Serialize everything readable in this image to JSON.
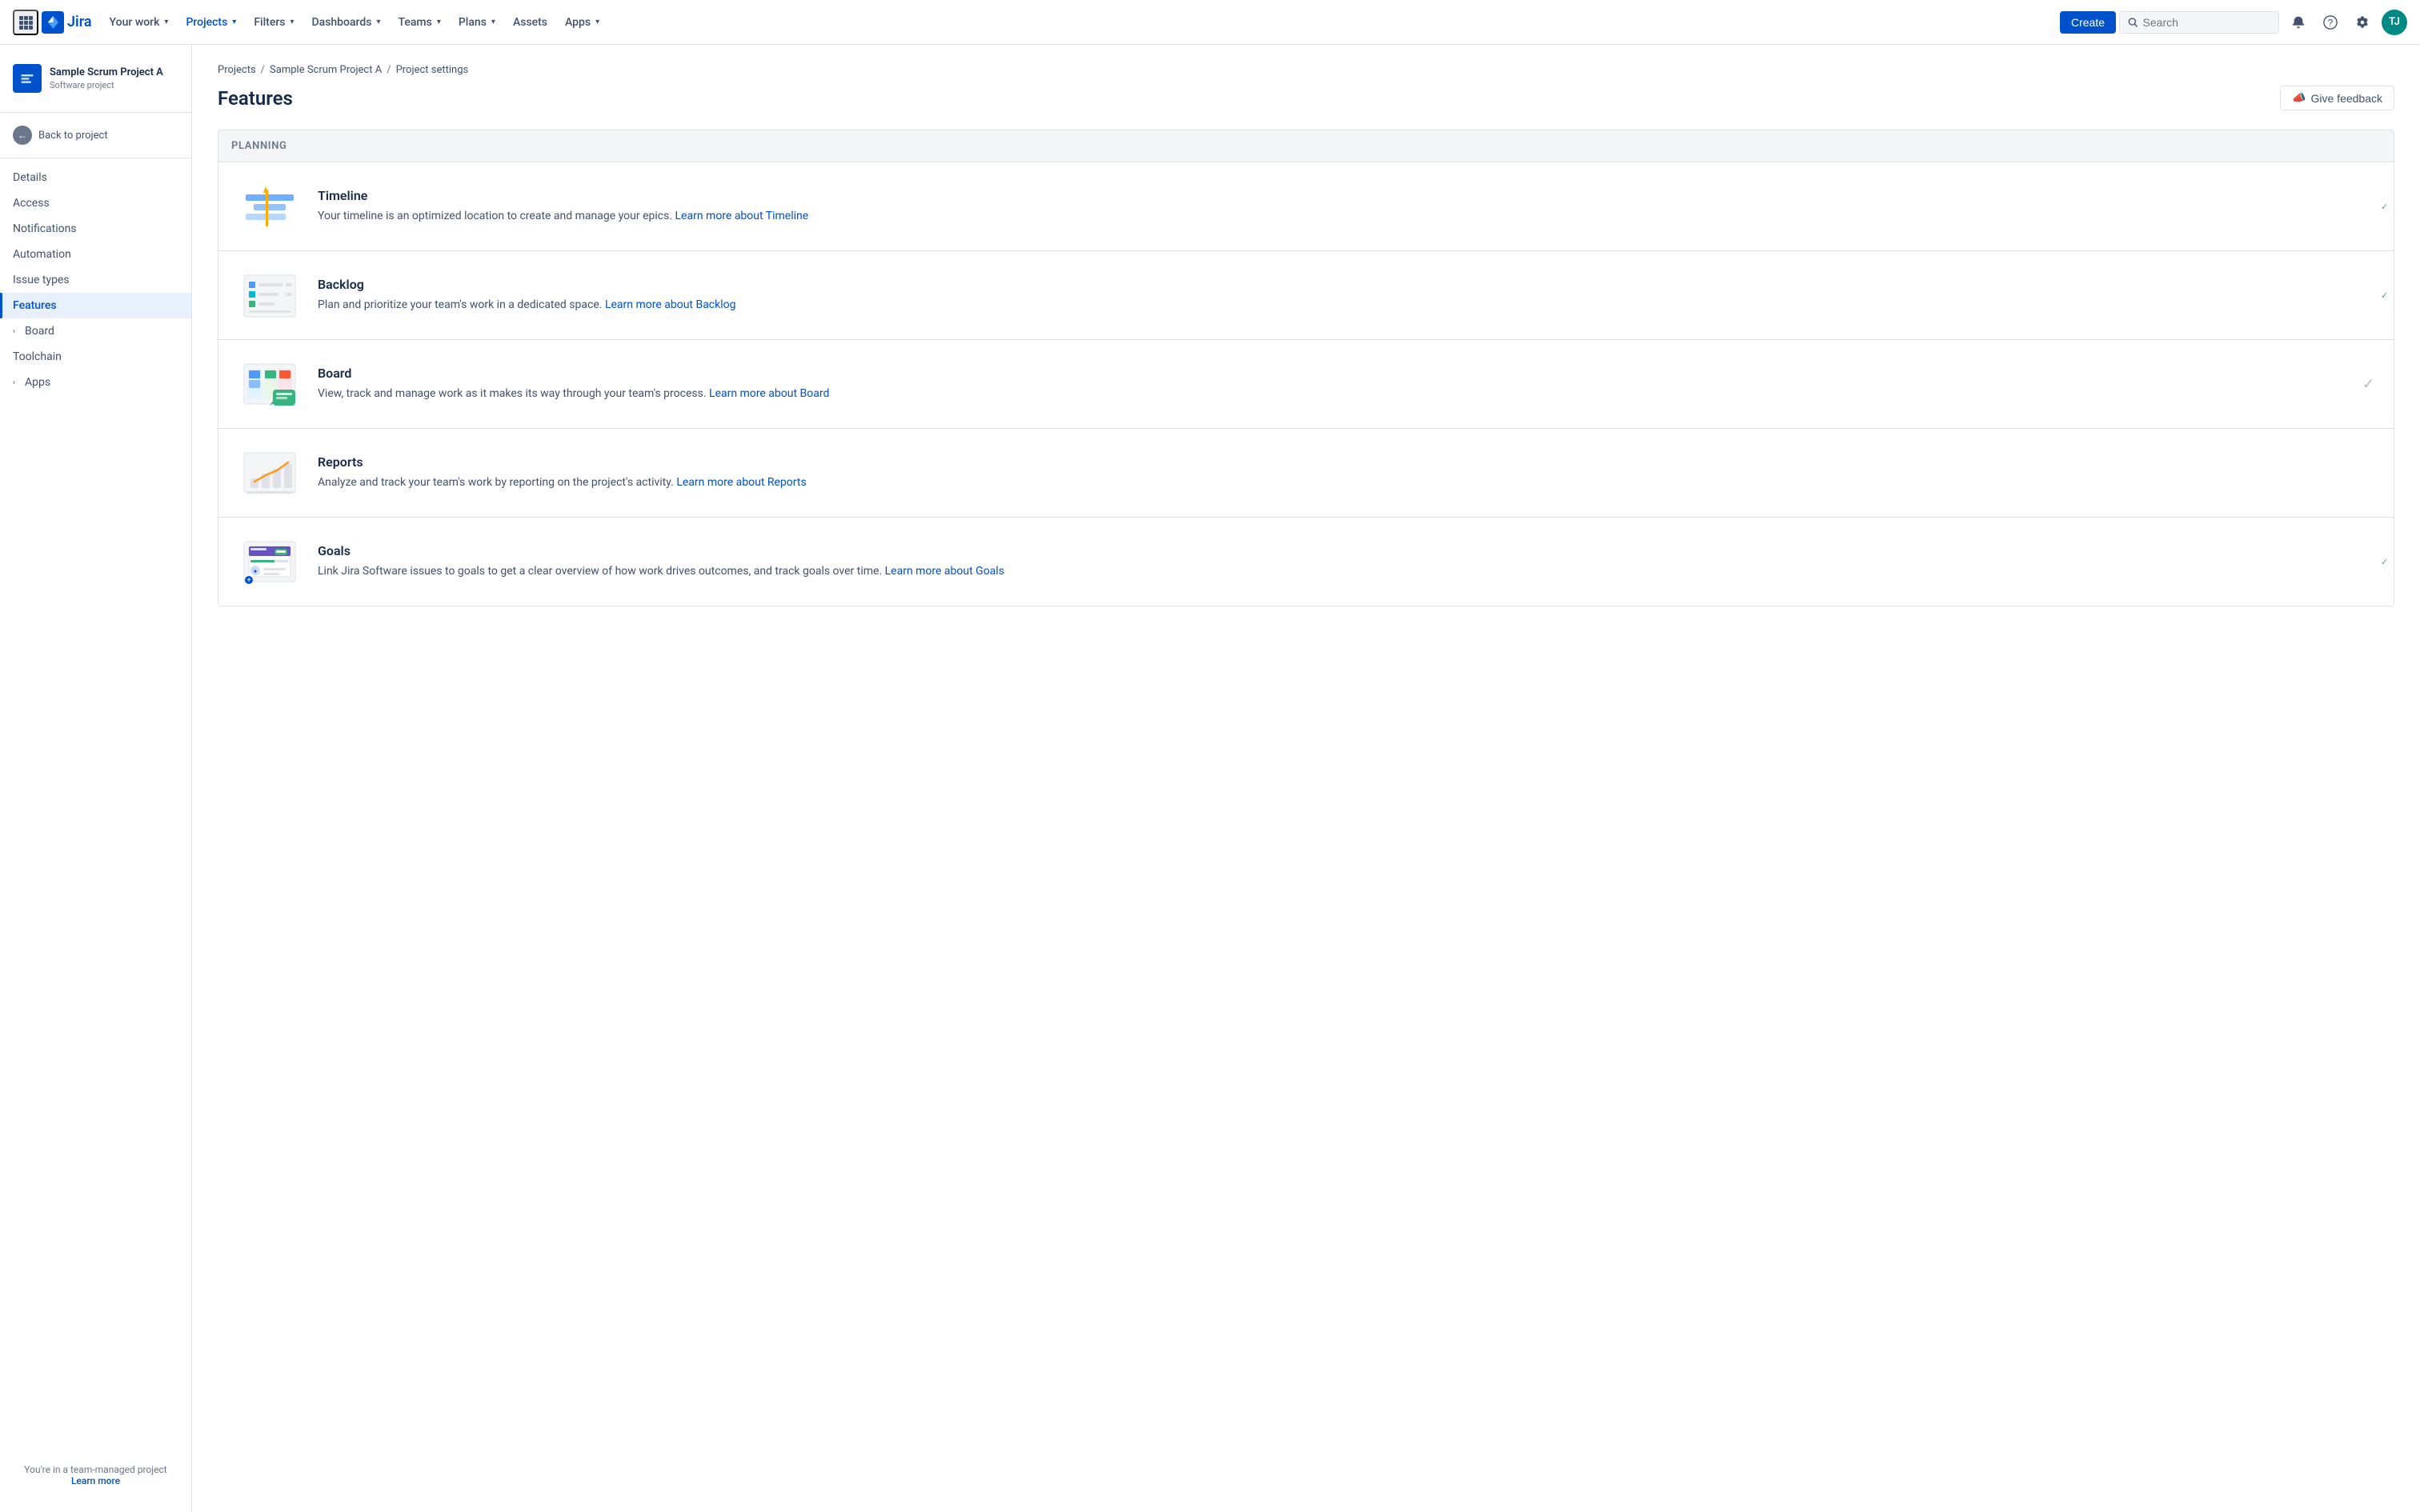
{
  "topnav": {
    "logo_text": "Jira",
    "nav_items": [
      {
        "label": "Your work",
        "has_chevron": true,
        "active": false
      },
      {
        "label": "Projects",
        "has_chevron": true,
        "active": true
      },
      {
        "label": "Filters",
        "has_chevron": true,
        "active": false
      },
      {
        "label": "Dashboards",
        "has_chevron": true,
        "active": false
      },
      {
        "label": "Teams",
        "has_chevron": true,
        "active": false
      },
      {
        "label": "Plans",
        "has_chevron": true,
        "active": false
      },
      {
        "label": "Assets",
        "has_chevron": false,
        "active": false
      },
      {
        "label": "Apps",
        "has_chevron": true,
        "active": false
      }
    ],
    "create_label": "Create",
    "search_placeholder": "Search",
    "avatar_initials": "TJ"
  },
  "sidebar": {
    "project_name": "Sample Scrum Project A",
    "project_type": "Software project",
    "back_label": "Back to project",
    "nav_items": [
      {
        "label": "Details",
        "active": false,
        "has_expand": false
      },
      {
        "label": "Access",
        "active": false,
        "has_expand": false
      },
      {
        "label": "Notifications",
        "active": false,
        "has_expand": false
      },
      {
        "label": "Automation",
        "active": false,
        "has_expand": false
      },
      {
        "label": "Issue types",
        "active": false,
        "has_expand": false
      },
      {
        "label": "Features",
        "active": true,
        "has_expand": false
      },
      {
        "label": "Board",
        "active": false,
        "has_expand": true
      },
      {
        "label": "Toolchain",
        "active": false,
        "has_expand": false
      },
      {
        "label": "Apps",
        "active": false,
        "has_expand": true
      }
    ],
    "footer_text": "You're in a team-managed project",
    "footer_link": "Learn more"
  },
  "breadcrumb": {
    "items": [
      "Projects",
      "Sample Scrum Project A",
      "Project settings"
    ]
  },
  "page": {
    "title": "Features",
    "give_feedback_label": "Give feedback"
  },
  "features": {
    "section_title": "Planning",
    "cards": [
      {
        "id": "timeline",
        "title": "Timeline",
        "description": "Your timeline is an optimized location to create and manage your epics.",
        "link_text": "Learn more about Timeline",
        "toggle_state": "on"
      },
      {
        "id": "backlog",
        "title": "Backlog",
        "description": "Plan and prioritize your team's work in a dedicated space.",
        "link_text": "Learn more about Backlog",
        "toggle_state": "on"
      },
      {
        "id": "board",
        "title": "Board",
        "description": "View, track and manage work as it makes its way through your team's process.",
        "link_text": "Learn more about Board",
        "toggle_state": "check"
      },
      {
        "id": "reports",
        "title": "Reports",
        "description": "Analyze and track your team's work by reporting on the project's activity.",
        "link_text": "Learn more about Reports",
        "toggle_state": "off"
      },
      {
        "id": "goals",
        "title": "Goals",
        "description": "Link Jira Software issues to goals to get a clear overview of how work drives outcomes, and track goals over time.",
        "link_text": "Learn more about Goals",
        "toggle_state": "on"
      }
    ]
  }
}
